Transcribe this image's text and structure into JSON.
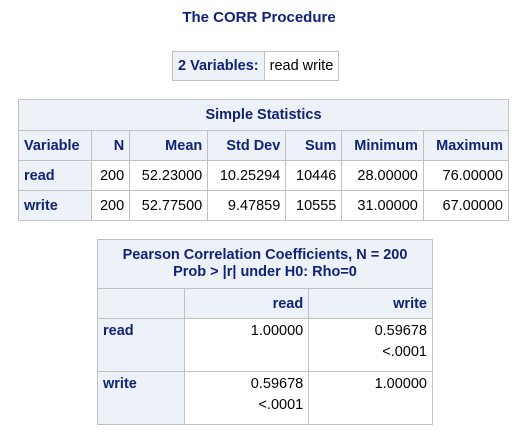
{
  "title": "The CORR Procedure",
  "variables": {
    "label": "2 Variables:",
    "value": "read write"
  },
  "simple_statistics": {
    "caption": "Simple Statistics",
    "columns": [
      "Variable",
      "N",
      "Mean",
      "Std Dev",
      "Sum",
      "Minimum",
      "Maximum"
    ],
    "rows": [
      {
        "variable": "read",
        "n": "200",
        "mean": "52.23000",
        "std_dev": "10.25294",
        "sum": "10446",
        "minimum": "28.00000",
        "maximum": "76.00000"
      },
      {
        "variable": "write",
        "n": "200",
        "mean": "52.77500",
        "std_dev": "9.47859",
        "sum": "10555",
        "minimum": "31.00000",
        "maximum": "67.00000"
      }
    ]
  },
  "pearson": {
    "caption_line1": "Pearson Correlation Coefficients, N = 200",
    "caption_line2": "Prob > |r| under H0: Rho=0",
    "columns": [
      "read",
      "write"
    ],
    "rows": [
      {
        "label": "read",
        "cells": [
          {
            "r": "1.00000",
            "p": ""
          },
          {
            "r": "0.59678",
            "p": "<.0001"
          }
        ]
      },
      {
        "label": "write",
        "cells": [
          {
            "r": "0.59678",
            "p": "<.0001"
          },
          {
            "r": "1.00000",
            "p": ""
          }
        ]
      }
    ]
  },
  "colors": {
    "header_background": "#edf2f9",
    "header_text": "#112277",
    "border": "#c1c1c1"
  }
}
